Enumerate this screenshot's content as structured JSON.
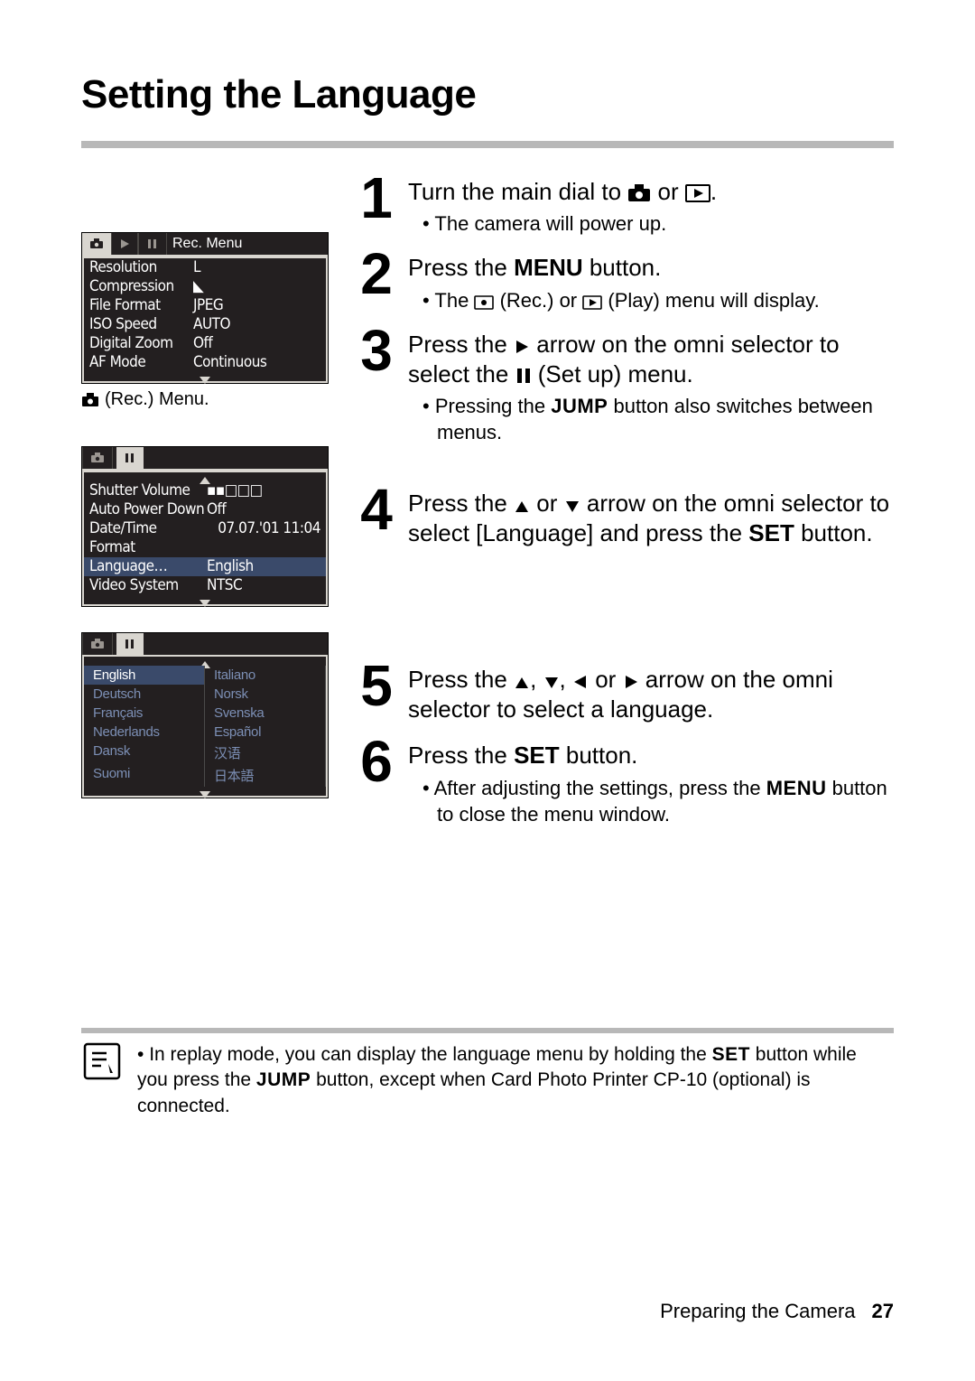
{
  "title": "Setting the Language",
  "lcd1": {
    "tab_title": "Rec. Menu",
    "rows": [
      {
        "k": "Resolution",
        "v": "L"
      },
      {
        "k": "Compression",
        "v": "◣"
      },
      {
        "k": "File Format",
        "v": "JPEG"
      },
      {
        "k": "ISO Speed",
        "v": "AUTO"
      },
      {
        "k": "Digital Zoom",
        "v": "Off"
      },
      {
        "k": "AF Mode",
        "v": "Continuous"
      }
    ]
  },
  "lcd1_caption": "(Rec.) Menu.",
  "lcd2": {
    "rows": [
      {
        "k": "Shutter Volume",
        "v": "▪▪□□□"
      },
      {
        "k": "Auto Power Down",
        "v": "Off"
      },
      {
        "k": "Date/Time",
        "v": "07.07.'01 11:04"
      },
      {
        "k": "Format",
        "v": ""
      },
      {
        "k": "Language…",
        "v": "English",
        "sel": true
      },
      {
        "k": "Video System",
        "v": "NTSC"
      }
    ]
  },
  "lcd3": {
    "langs": [
      [
        "English",
        "Italiano"
      ],
      [
        "Deutsch",
        "Norsk"
      ],
      [
        "Français",
        "Svenska"
      ],
      [
        "Nederlands",
        "Español"
      ],
      [
        "Dansk",
        "汉语"
      ],
      [
        "Suomi",
        "日本語"
      ]
    ]
  },
  "steps": {
    "s1_head_a": "Turn the main dial to ",
    "s1_head_b": " or ",
    "s1_head_c": ".",
    "s1_b1": "The camera will power up.",
    "s2_head_a": "Press the ",
    "s2_head_b": "MENU",
    "s2_head_c": " button.",
    "s2_b1_a": "The ",
    "s2_b1_b": " (Rec.) or ",
    "s2_b1_c": " (Play) menu will display.",
    "s3_head_a": "Press the ",
    "s3_head_b": " arrow on the omni selector to select the ",
    "s3_head_c": " (Set up) menu.",
    "s3_b1_a": "Pressing the ",
    "s3_b1_b": "JUMP",
    "s3_b1_c": " button also switches between menus.",
    "s4_head_a": "Press the ",
    "s4_head_b": " or ",
    "s4_head_c": " arrow on the omni selector to select [Language] and press the ",
    "s4_head_d": "SET",
    "s4_head_e": " button.",
    "s5_head_a": "Press the ",
    "s5_head_b": ", ",
    "s5_head_c": ", ",
    "s5_head_d": " or ",
    "s5_head_e": " arrow on the omni selector to select a language.",
    "s6_head_a": "Press the ",
    "s6_head_b": "SET",
    "s6_head_c": " button.",
    "s6_b1_a": "After adjusting the settings, press the ",
    "s6_b1_b": "MENU",
    "s6_b1_c": " button to close the menu window."
  },
  "note_a": "In replay mode, you can display the language menu by holding the ",
  "note_b": "SET",
  "note_c": " button while you press the ",
  "note_d": "JUMP",
  "note_e": " button, except when Card Photo Printer CP-10 (optional) is connected.",
  "footer_label": "Preparing the Camera",
  "footer_page": "27",
  "nums": {
    "n1": "1",
    "n2": "2",
    "n3": "3",
    "n4": "4",
    "n5": "5",
    "n6": "6"
  }
}
